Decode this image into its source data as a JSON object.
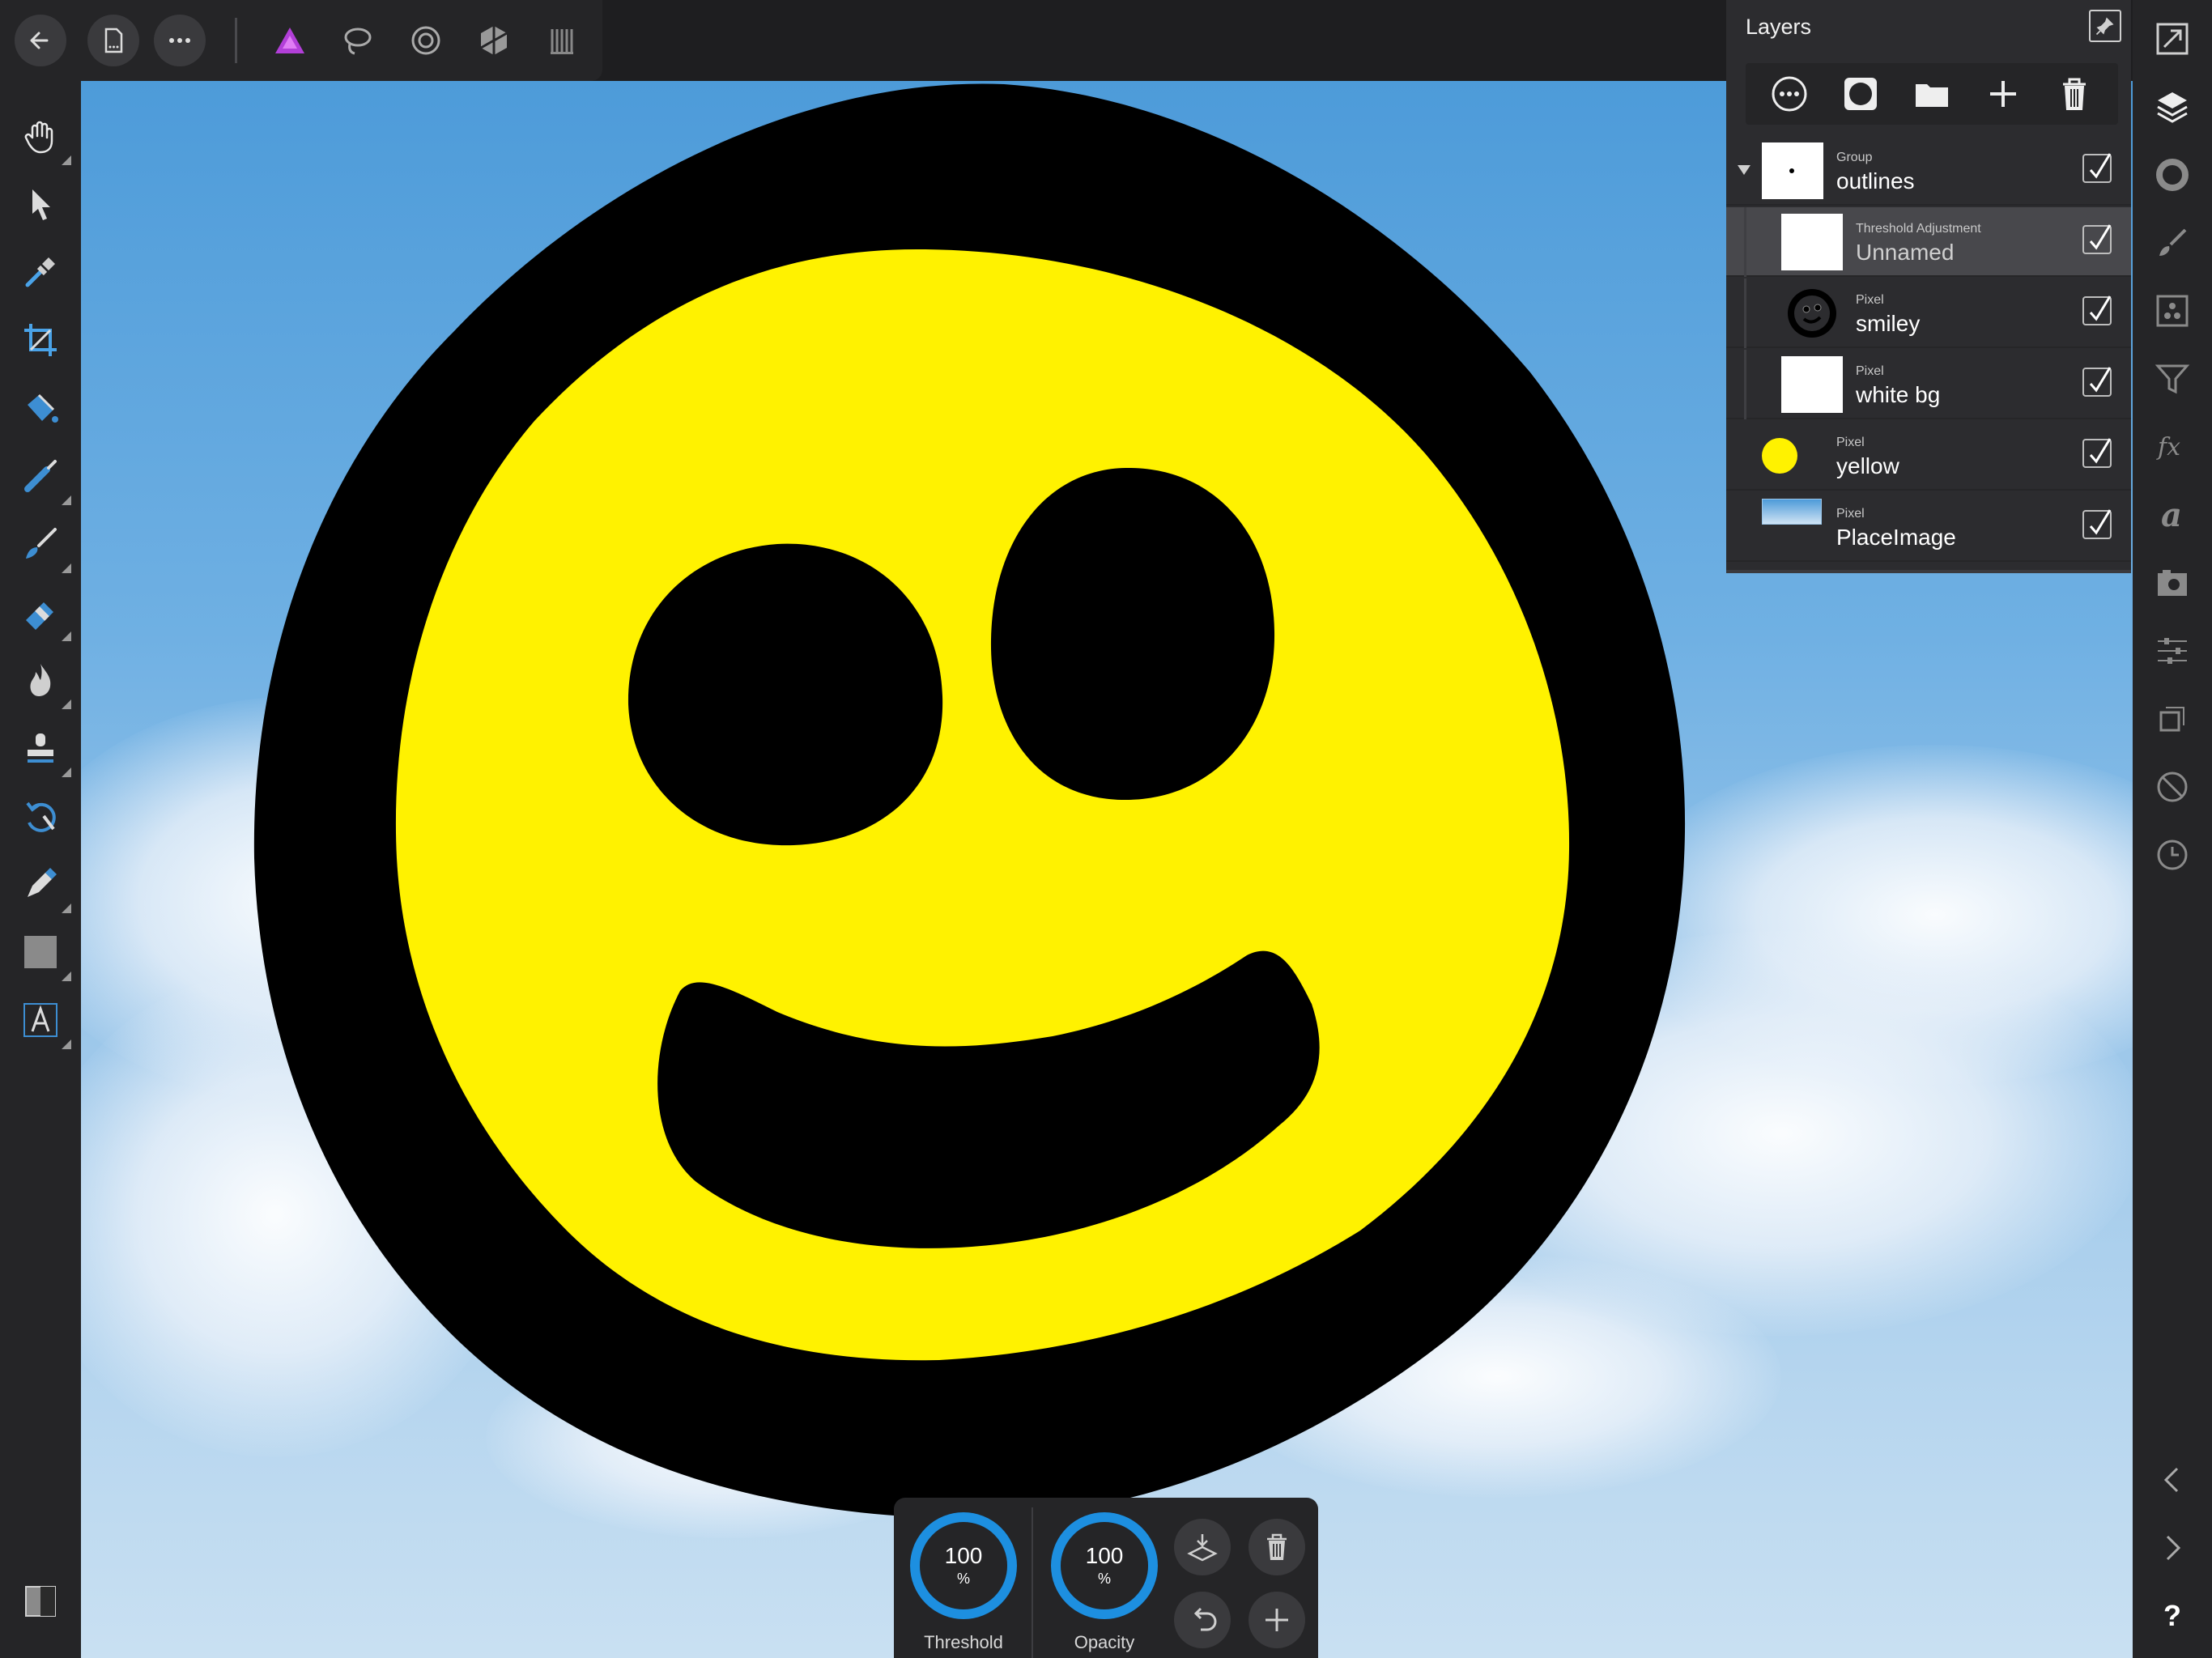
{
  "app": {
    "name": "Affinity Photo"
  },
  "top_toolbar": {
    "buttons": [
      {
        "icon": "back-arrow-icon"
      },
      {
        "icon": "document-icon"
      },
      {
        "icon": "more-icon"
      }
    ],
    "personas": [
      {
        "icon": "photo-persona-icon"
      },
      {
        "icon": "liquify-persona-icon"
      },
      {
        "icon": "develop-persona-icon"
      },
      {
        "icon": "tone-mapping-persona-icon"
      },
      {
        "icon": "export-persona-icon"
      }
    ]
  },
  "left_toolbar": {
    "tools": [
      "hand-tool",
      "move-tool",
      "color-picker-tool",
      "crop-tool",
      "flood-fill-tool",
      "selection-brush-tool",
      "paint-brush-tool",
      "erase-brush-tool",
      "dodge-burn-tool",
      "clone-tool",
      "undo-brush-tool",
      "pen-tool",
      "rectangle-tool",
      "text-tool"
    ],
    "bottom": "color-swatch"
  },
  "layers_panel": {
    "title": "Layers",
    "actions": [
      "layer-options",
      "mask",
      "group-folder",
      "add-layer",
      "delete-layer"
    ],
    "layers": [
      {
        "type": "Group",
        "name": "outlines",
        "visible": true,
        "expanded": true
      },
      {
        "type": "Threshold Adjustment",
        "name": "Unnamed",
        "visible": true,
        "selected": true
      },
      {
        "type": "Pixel",
        "name": "smiley",
        "visible": true
      },
      {
        "type": "Pixel",
        "name": "white bg",
        "visible": true
      },
      {
        "type": "Pixel",
        "name": "yellow",
        "visible": true
      },
      {
        "type": "Pixel",
        "name": "PlaceImage",
        "visible": true
      }
    ]
  },
  "context_panel": {
    "threshold": {
      "value": "100",
      "unit": "%",
      "label": "Threshold",
      "fraction": 1.0
    },
    "opacity": {
      "value": "100",
      "unit": "%",
      "label": "Opacity",
      "fraction": 1.0
    }
  },
  "right_studio": {
    "icons": [
      "navigator-icon",
      "layers-icon",
      "color-icon",
      "brushes-icon",
      "channels-icon",
      "adjustments-icon",
      "fx-icon",
      "text-styles-icon",
      "snapshot-icon",
      "sliders-icon",
      "transform-icon",
      "mask-icon",
      "history-icon"
    ],
    "bottom": [
      "chevron-left-icon",
      "chevron-right-icon",
      "help-icon"
    ],
    "help_label": "?"
  },
  "colors": {
    "accent": "#1d8fe0",
    "smiley_face": "#fff200",
    "outline": "#000000",
    "sky": "#5ea6df"
  }
}
